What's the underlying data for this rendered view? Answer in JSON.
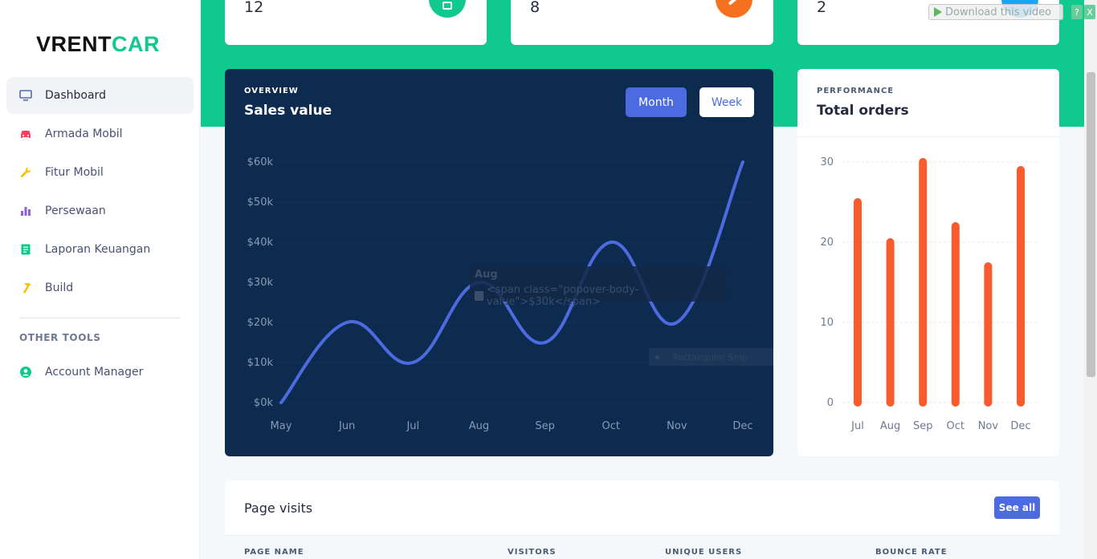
{
  "logo": {
    "part1": "VRENT",
    "part2": "CAR"
  },
  "sidebar": {
    "items": [
      {
        "label": "Dashboard",
        "icon": "monitor-icon",
        "color": "#5b6aa8"
      },
      {
        "label": "Armada Mobil",
        "icon": "car-icon",
        "color": "#fa3e5c"
      },
      {
        "label": "Fitur Mobil",
        "icon": "wrench-icon",
        "color": "#f7c200"
      },
      {
        "label": "Persewaan",
        "icon": "bar-chart-icon",
        "color": "#8a63d2"
      },
      {
        "label": "Laporan Keuangan",
        "icon": "book-icon",
        "color": "#10c98f"
      },
      {
        "label": "Build",
        "icon": "hammer-icon",
        "color": "#f7c200"
      }
    ],
    "tools_label": "OTHER TOOLS",
    "tools": [
      {
        "label": "Account Manager",
        "icon": "user-circle-icon",
        "color": "#10c98f"
      }
    ]
  },
  "stats": [
    {
      "value": "12",
      "color": "#10c98f"
    },
    {
      "value": "8",
      "color": "#f5701f"
    },
    {
      "value": "2",
      "color": "#1aa6f0"
    }
  ],
  "sales": {
    "eyebrow": "OVERVIEW",
    "title": "Sales value",
    "btn_month": "Month",
    "btn_week": "Week"
  },
  "tooltip": {
    "title": "Aug",
    "body": "<span class=\"popover-body-value\">$30k</span>"
  },
  "snip_label": "Rectangular Snip",
  "orders": {
    "eyebrow": "PERFORMANCE",
    "title": "Total orders"
  },
  "chart_data": [
    {
      "type": "line",
      "categories": [
        "May",
        "Jun",
        "Jul",
        "Aug",
        "Sep",
        "Oct",
        "Nov",
        "Dec"
      ],
      "values": [
        0,
        20,
        10,
        30,
        15,
        40,
        20,
        60
      ],
      "yticks": [
        "$0k",
        "$10k",
        "$20k",
        "$30k",
        "$40k",
        "$50k",
        "$60k"
      ],
      "ylim": [
        0,
        60
      ],
      "line_color": "#4d6be0"
    },
    {
      "type": "bar",
      "categories": [
        "Jul",
        "Aug",
        "Sep",
        "Oct",
        "Nov",
        "Dec"
      ],
      "values": [
        25,
        20,
        30,
        22,
        17,
        29
      ],
      "yticks": [
        "0",
        "10",
        "20",
        "30"
      ],
      "ylim": [
        0,
        30
      ],
      "bar_color": "#fa5b2c"
    }
  ],
  "visits": {
    "title": "Page visits",
    "see_all": "See all",
    "columns": [
      "PAGE NAME",
      "VISITORS",
      "UNIQUE USERS",
      "BOUNCE RATE"
    ]
  },
  "download": {
    "label": "Download this video",
    "help": "?",
    "close": "X"
  }
}
